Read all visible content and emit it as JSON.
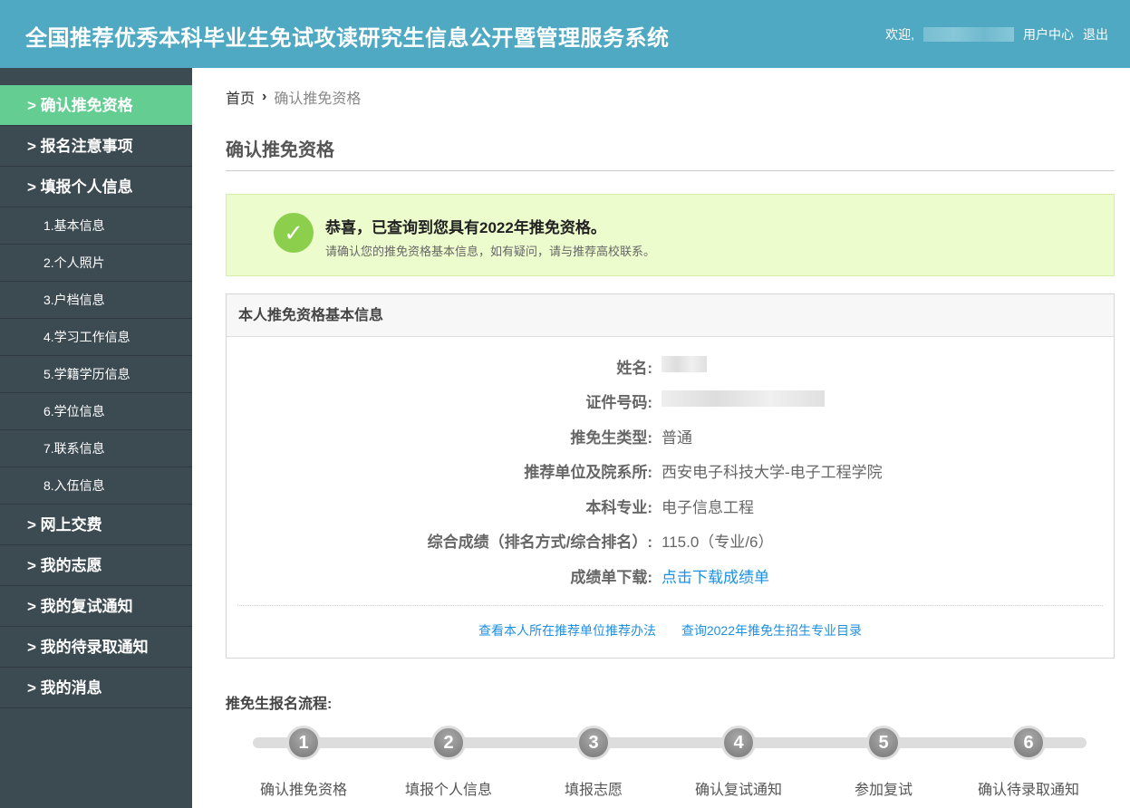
{
  "header": {
    "title": "全国推荐优秀本科毕业生免试攻读研究生信息公开暨管理服务系统",
    "welcome": "欢迎,",
    "user_center": "用户中心",
    "logout": "退出"
  },
  "sidebar": {
    "items": [
      {
        "label": "> 确认推免资格",
        "type": "main",
        "active": true
      },
      {
        "label": "> 报名注意事项",
        "type": "main"
      },
      {
        "label": "> 填报个人信息",
        "type": "main"
      },
      {
        "label": "1.基本信息",
        "type": "sub"
      },
      {
        "label": "2.个人照片",
        "type": "sub"
      },
      {
        "label": "3.户档信息",
        "type": "sub"
      },
      {
        "label": "4.学习工作信息",
        "type": "sub"
      },
      {
        "label": "5.学籍学历信息",
        "type": "sub"
      },
      {
        "label": "6.学位信息",
        "type": "sub"
      },
      {
        "label": "7.联系信息",
        "type": "sub"
      },
      {
        "label": "8.入伍信息",
        "type": "sub"
      },
      {
        "label": "> 网上交费",
        "type": "main"
      },
      {
        "label": "> 我的志愿",
        "type": "main"
      },
      {
        "label": "> 我的复试通知",
        "type": "main"
      },
      {
        "label": "> 我的待录取通知",
        "type": "main"
      },
      {
        "label": "> 我的消息",
        "type": "main"
      }
    ]
  },
  "breadcrumb": {
    "home": "首页",
    "sep": "›",
    "current": "确认推免资格"
  },
  "page_title": "确认推免资格",
  "alert": {
    "title": "恭喜，已查询到您具有2022年推免资格。",
    "subtitle": "请确认您的推免资格基本信息，如有疑问，请与推荐高校联系。"
  },
  "panel": {
    "title": "本人推免资格基本信息",
    "rows": [
      {
        "label": "姓名:",
        "value": null
      },
      {
        "label": "证件号码:",
        "value": null
      },
      {
        "label": "推免生类型:",
        "value": "普通"
      },
      {
        "label": "推荐单位及院系所:",
        "value": "西安电子科技大学-电子工程学院"
      },
      {
        "label": "本科专业:",
        "value": "电子信息工程"
      },
      {
        "label": "综合成绩（排名方式/综合排名）:",
        "value": "115.0（专业/6）"
      },
      {
        "label": "成绩单下载:",
        "value": "点击下载成绩单",
        "link": true
      }
    ],
    "links": [
      "查看本人所在推荐单位推荐办法",
      "查询2022年推免生招生专业目录"
    ]
  },
  "flow": {
    "title": "推免生报名流程:",
    "steps": [
      {
        "num": "1",
        "label": "确认推免资格"
      },
      {
        "num": "2",
        "label": "填报个人信息"
      },
      {
        "num": "3",
        "label": "填报志愿"
      },
      {
        "num": "4",
        "label": "确认复试通知"
      },
      {
        "num": "5",
        "label": "参加复试"
      },
      {
        "num": "6",
        "label": "确认待录取通知"
      }
    ]
  }
}
